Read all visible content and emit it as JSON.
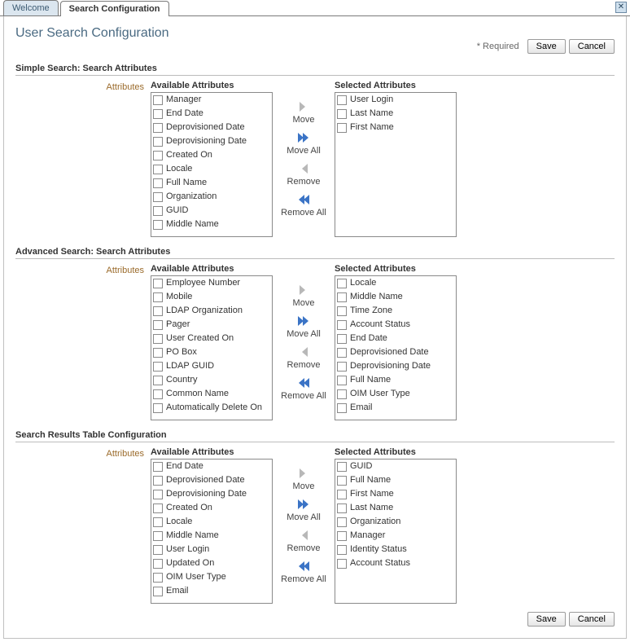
{
  "tabs": {
    "welcome": "Welcome",
    "search_config": "Search Configuration"
  },
  "title": "User Search Configuration",
  "required_label": "* Required",
  "buttons": {
    "save": "Save",
    "cancel": "Cancel"
  },
  "shuttle_labels": {
    "attributes": "Attributes",
    "available": "Available Attributes",
    "selected": "Selected Attributes",
    "move": "Move",
    "move_all": "Move All",
    "remove": "Remove",
    "remove_all": "Remove All"
  },
  "sections": {
    "simple": {
      "heading": "Simple Search: Search Attributes",
      "available": [
        "Manager",
        "End Date",
        "Deprovisioned Date",
        "Deprovisioning Date",
        "Created On",
        "Locale",
        "Full Name",
        "Organization",
        "GUID",
        "Middle Name"
      ],
      "selected": [
        "User Login",
        "Last Name",
        "First Name"
      ]
    },
    "advanced": {
      "heading": "Advanced Search: Search Attributes",
      "available": [
        "Employee Number",
        "Mobile",
        "LDAP Organization",
        "Pager",
        "User Created On",
        "PO Box",
        "LDAP GUID",
        "Country",
        "Common Name",
        "Automatically Delete On"
      ],
      "selected": [
        "Locale",
        "Middle Name",
        "Time Zone",
        "Account Status",
        "End Date",
        "Deprovisioned Date",
        "Deprovisioning Date",
        "Full Name",
        "OIM User Type",
        "Email"
      ]
    },
    "results": {
      "heading": "Search Results Table Configuration",
      "available": [
        "End Date",
        "Deprovisioned Date",
        "Deprovisioning Date",
        "Created On",
        "Locale",
        "Middle Name",
        "User Login",
        "Updated On",
        "OIM User Type",
        "Email"
      ],
      "selected": [
        "GUID",
        "Full Name",
        "First Name",
        "Last Name",
        "Organization",
        "Manager",
        "Identity Status",
        "Account Status"
      ]
    }
  }
}
